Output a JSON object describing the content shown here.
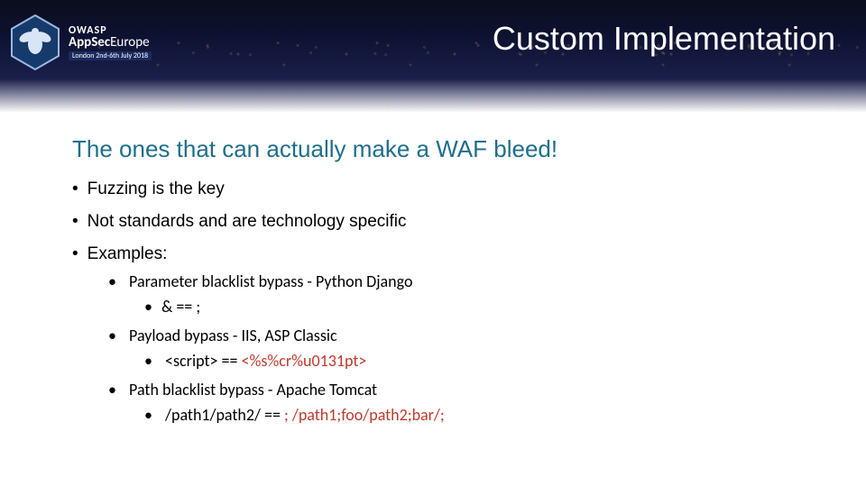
{
  "logo": {
    "line1": "OWASP",
    "line2_strong": "AppSec",
    "line2_light": "Europe",
    "line3": "London 2nd-6th July 2018"
  },
  "title": "Custom Implementation",
  "headline": "The ones that can actually make a WAF bleed!",
  "bullets": {
    "b1": "Fuzzing is the key",
    "b2": "Not standards and are technology specific",
    "b3": "Examples:",
    "examples": {
      "e1": {
        "label": "Parameter blacklist bypass - Python Django",
        "detail": "& == ;"
      },
      "e2": {
        "label": "Payload bypass - IIS, ASP Classic",
        "detail_prefix": "<script> == ",
        "detail_red": "<%s%cr%u0131pt>"
      },
      "e3": {
        "label": "Path blacklist bypass - Apache Tomcat",
        "detail_prefix": "/path1/path2/ == ",
        "detail_red": "; /path1;foo/path2;bar/;"
      }
    }
  }
}
